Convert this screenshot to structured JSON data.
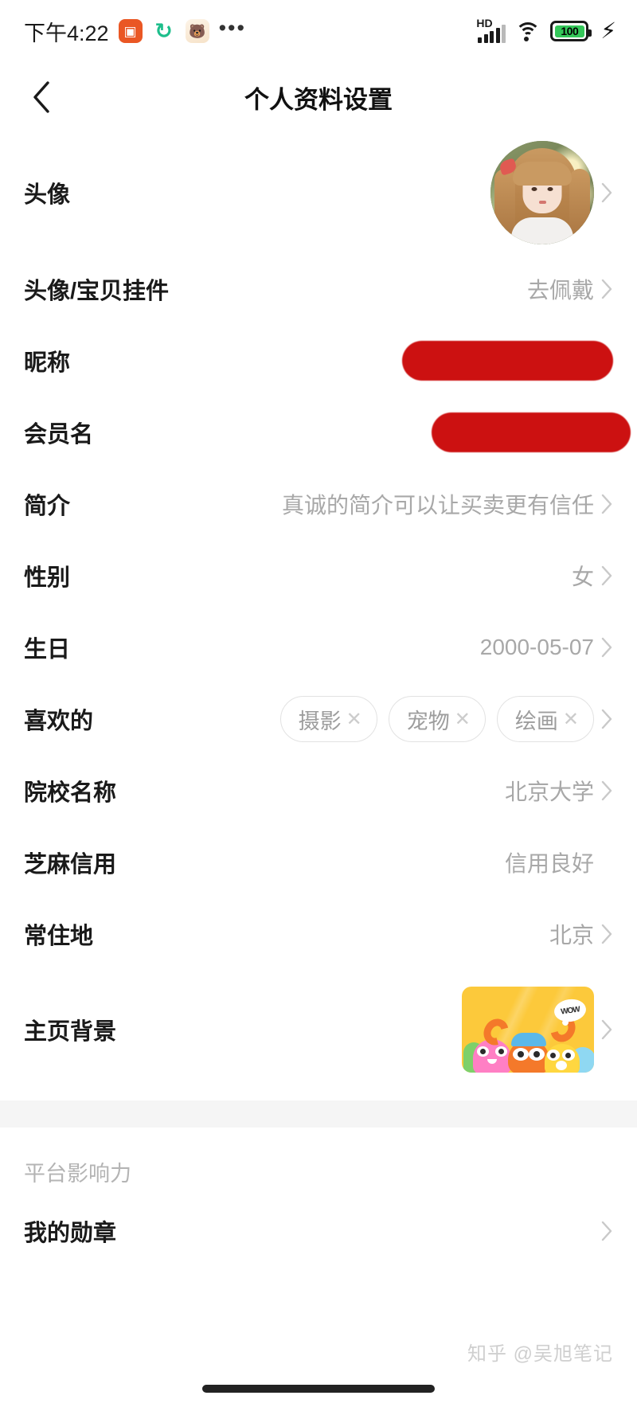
{
  "status_bar": {
    "time": "下午4:22",
    "network_label": "HD",
    "battery_level": "100",
    "icons": [
      "video-app-icon",
      "sync-icon",
      "bear-app-icon",
      "more-dots-icon",
      "hd-signal-icon",
      "wifi-icon",
      "battery-icon",
      "charging-bolt-icon"
    ],
    "more_dots": "•••",
    "bolt": "⚡",
    "battery_fill_color": "#34C759",
    "video_icon_color": "#EA5724",
    "sync_icon_color": "#1DBE8B",
    "sync_glyph": "↻",
    "video_glyph": "▣",
    "bear_glyph": "🐻"
  },
  "nav": {
    "back_icon": "chevron-left-icon",
    "title": "个人资料设置"
  },
  "rows": [
    {
      "label": "头像",
      "value": "",
      "type": "avatar",
      "chevron": true
    },
    {
      "label": "头像/宝贝挂件",
      "value": "去佩戴",
      "type": "text",
      "chevron": true
    },
    {
      "label": "昵称",
      "value": "",
      "type": "redacted",
      "chevron": false
    },
    {
      "label": "会员名",
      "value": "",
      "type": "redacted",
      "chevron": false
    },
    {
      "label": "简介",
      "value": "真诚的简介可以让买卖更有信任",
      "type": "text",
      "chevron": true
    },
    {
      "label": "性别",
      "value": "女",
      "type": "text",
      "chevron": true
    },
    {
      "label": "生日",
      "value": "2000-05-07",
      "type": "text",
      "chevron": true
    },
    {
      "label": "喜欢的",
      "value": "",
      "type": "tags",
      "chevron": true
    },
    {
      "label": "院校名称",
      "value": "北京大学",
      "type": "text",
      "chevron": true
    },
    {
      "label": "芝麻信用",
      "value": "信用良好",
      "type": "text",
      "chevron": false
    },
    {
      "label": "常住地",
      "value": "北京",
      "type": "text",
      "chevron": true
    },
    {
      "label": "主页背景",
      "value": "",
      "type": "thumbnail",
      "chevron": true
    }
  ],
  "interest_tags": [
    {
      "label": "摄影",
      "remove": "✕"
    },
    {
      "label": "宠物",
      "remove": "✕"
    },
    {
      "label": "绘画",
      "remove": "✕"
    }
  ],
  "section": {
    "title": "平台影响力",
    "items": [
      {
        "label": "我的勋章",
        "chevron": true
      }
    ]
  },
  "thumbnail": {
    "wow_text": "WOW",
    "bg_color": "#FCC93B"
  },
  "watermark": "知乎 @吴旭笔记",
  "colors": {
    "label": "#1a1a1a",
    "value": "#a8a8a8",
    "redaction": "#CC1111",
    "divider": "#f5f5f5"
  }
}
